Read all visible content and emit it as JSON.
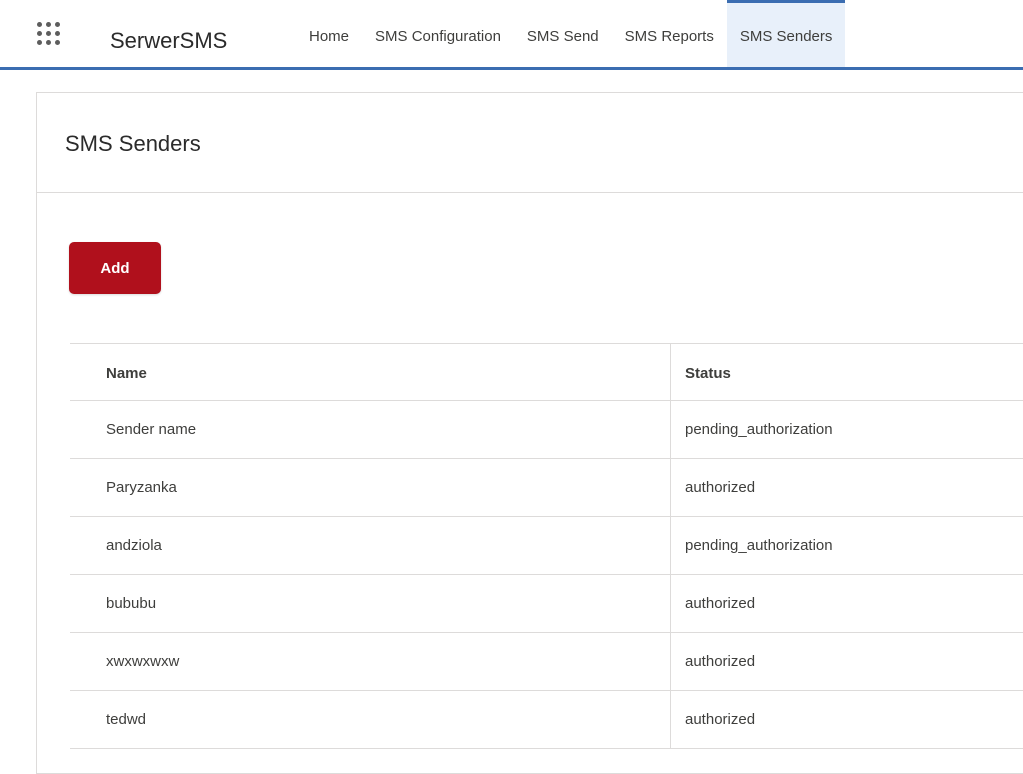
{
  "header": {
    "app_name": "SerwerSMS",
    "launcher_icon": "app-launcher-icon",
    "accent_color": "#3b6db1",
    "nav": [
      {
        "label": "Home",
        "active": false
      },
      {
        "label": "SMS Configuration",
        "active": false
      },
      {
        "label": "SMS Send",
        "active": false
      },
      {
        "label": "SMS Reports",
        "active": false
      },
      {
        "label": "SMS Senders",
        "active": true
      }
    ]
  },
  "page": {
    "title": "SMS Senders",
    "add_label": "Add",
    "add_color": "#b0101c"
  },
  "table": {
    "columns": [
      "Name",
      "Status"
    ],
    "rows": [
      {
        "name": "Sender name",
        "status": "pending_authorization"
      },
      {
        "name": "Paryzanka",
        "status": "authorized"
      },
      {
        "name": "andziola",
        "status": "pending_authorization"
      },
      {
        "name": "bububu",
        "status": "authorized"
      },
      {
        "name": "xwxwxwxw",
        "status": "authorized"
      },
      {
        "name": "tedwd",
        "status": "authorized"
      }
    ]
  }
}
